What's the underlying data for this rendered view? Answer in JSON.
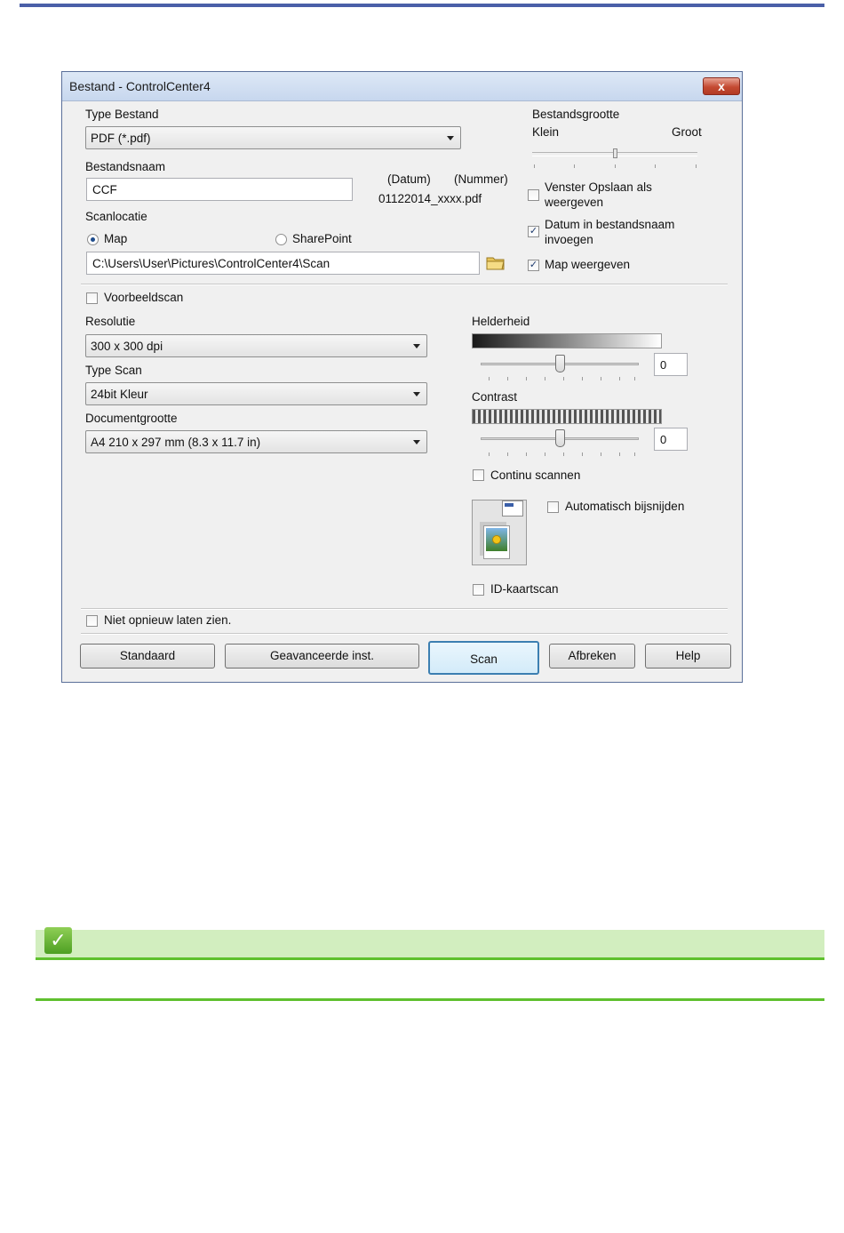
{
  "dialog": {
    "title": "Bestand - ControlCenter4",
    "close_glyph": "x",
    "file_type": {
      "label": "Type Bestand",
      "value": "PDF (*.pdf)"
    },
    "file_name": {
      "label": "Bestandsnaam",
      "value": "CCF",
      "date_header": "(Datum)",
      "number_header": "(Nummer)",
      "preview": "01122014_xxxx.pdf"
    },
    "scan_location": {
      "label": "Scanlocatie",
      "option_map": "Map",
      "option_sharepoint": "SharePoint",
      "selected": "Map",
      "path": "C:\\Users\\User\\Pictures\\ControlCenter4\\Scan"
    },
    "file_size": {
      "label": "Bestandsgrootte",
      "small": "Klein",
      "large": "Groot"
    },
    "options": {
      "show_save_window_1": "Venster Opslaan als",
      "show_save_window_2": "weergeven",
      "show_save_window_checked": false,
      "date_in_name_1": "Datum in bestandsnaam",
      "date_in_name_2": "invoegen",
      "date_in_name_checked": true,
      "show_folder": "Map weergeven",
      "show_folder_checked": true
    },
    "preview_scan": "Voorbeeldscan",
    "resolution": {
      "label": "Resolutie",
      "value": "300 x 300 dpi"
    },
    "scan_type": {
      "label": "Type Scan",
      "value": "24bit Kleur"
    },
    "document_size": {
      "label": "Documentgrootte",
      "value": "A4 210 x 297 mm (8.3 x 11.7 in)"
    },
    "brightness": {
      "label": "Helderheid",
      "value": "0"
    },
    "contrast": {
      "label": "Contrast",
      "value": "0"
    },
    "continuous_scan": "Continu scannen",
    "auto_crop": "Automatisch bijsnijden",
    "id_card_scan": "ID-kaartscan",
    "dont_show_again": "Niet opnieuw laten zien.",
    "buttons": {
      "default": "Standaard",
      "advanced": "Geavanceerde inst.",
      "scan": "Scan",
      "cancel": "Afbreken",
      "help": "Help"
    }
  },
  "note": {
    "icon": "checkmark-icon",
    "icon_glyph": "✓"
  },
  "colors": {
    "accent_bar": "#4a5fa8",
    "note_green": "#5fc02e",
    "note_bg": "#d2eebf"
  }
}
